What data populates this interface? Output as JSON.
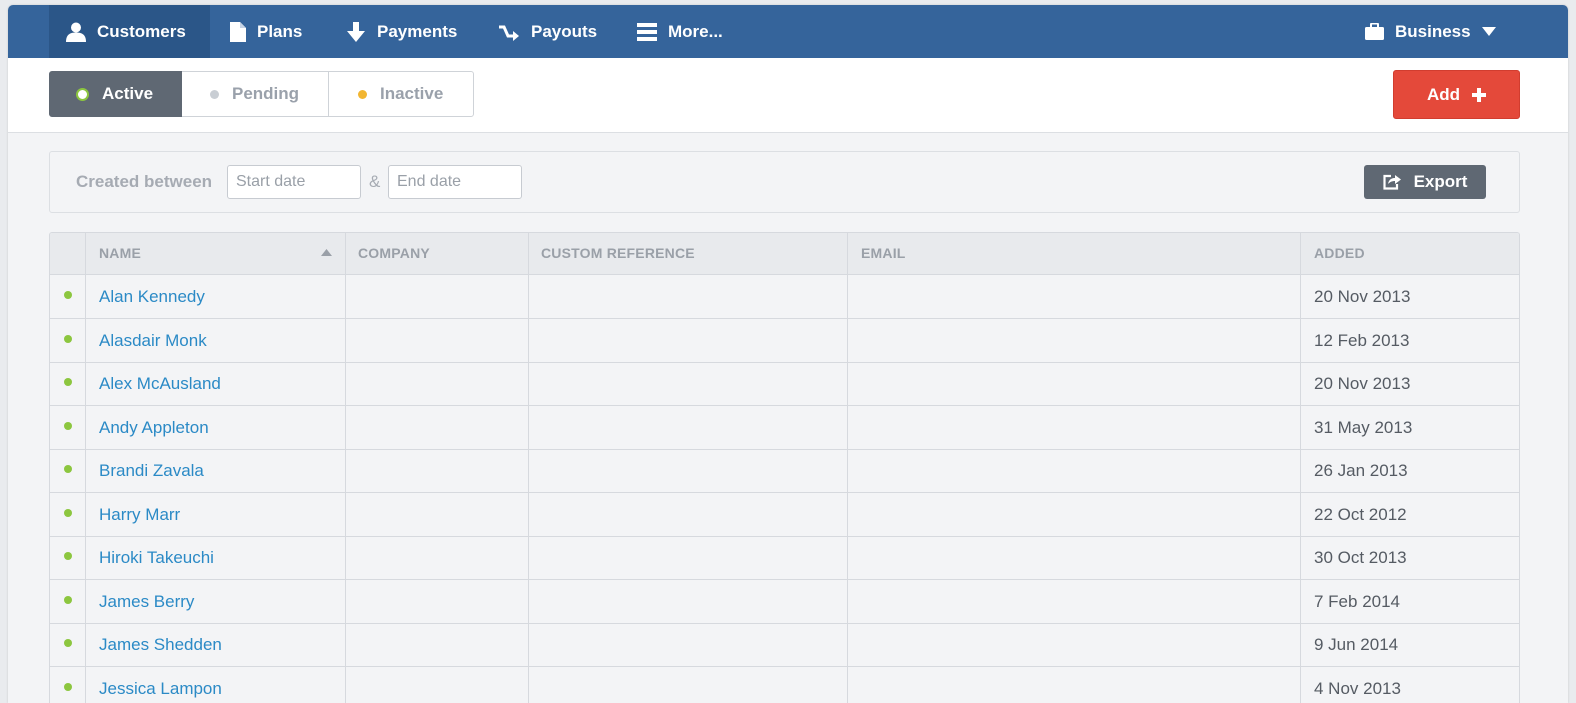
{
  "colors": {
    "nav_bg": "#35649b",
    "nav_active": "#2b5688",
    "accent_red": "#e4493a",
    "link_blue": "#2b8ac6",
    "status_active": "#8cc63f",
    "status_pending": "#c9ced4",
    "status_inactive": "#f2b632"
  },
  "nav": {
    "items": [
      {
        "label": "Customers",
        "icon": "user-icon"
      },
      {
        "label": "Plans",
        "icon": "document-icon"
      },
      {
        "label": "Payments",
        "icon": "download-arrow-icon"
      },
      {
        "label": "Payouts",
        "icon": "payout-arrow-icon"
      },
      {
        "label": "More...",
        "icon": "menu-icon"
      }
    ],
    "business": {
      "label": "Business",
      "icon": "briefcase-icon"
    }
  },
  "tabs": [
    {
      "label": "Active"
    },
    {
      "label": "Pending"
    },
    {
      "label": "Inactive"
    }
  ],
  "add_button": {
    "label": "Add"
  },
  "filter": {
    "label": "Created between",
    "start_placeholder": "Start date",
    "separator": "&",
    "end_placeholder": "End date",
    "export_label": "Export"
  },
  "table": {
    "columns": [
      "NAME",
      "COMPANY",
      "CUSTOM REFERENCE",
      "EMAIL",
      "ADDED"
    ],
    "sort_icon": "sort-up-icon",
    "rows": [
      {
        "name": "Alan Kennedy",
        "company": "",
        "reference": "",
        "email": "",
        "added": "20 Nov 2013"
      },
      {
        "name": "Alasdair Monk",
        "company": "",
        "reference": "",
        "email": "",
        "added": "12 Feb 2013"
      },
      {
        "name": "Alex McAusland",
        "company": "",
        "reference": "",
        "email": "",
        "added": "20 Nov 2013"
      },
      {
        "name": "Andy Appleton",
        "company": "",
        "reference": "",
        "email": "",
        "added": "31 May 2013"
      },
      {
        "name": "Brandi Zavala",
        "company": "",
        "reference": "",
        "email": "",
        "added": "26 Jan 2013"
      },
      {
        "name": "Harry Marr",
        "company": "",
        "reference": "",
        "email": "",
        "added": "22 Oct 2012"
      },
      {
        "name": "Hiroki Takeuchi",
        "company": "",
        "reference": "",
        "email": "",
        "added": "30 Oct 2013"
      },
      {
        "name": "James Berry",
        "company": "",
        "reference": "",
        "email": "",
        "added": "7 Feb 2014"
      },
      {
        "name": "James Shedden",
        "company": "",
        "reference": "",
        "email": "",
        "added": "9 Jun 2014"
      },
      {
        "name": "Jessica Lampon",
        "company": "",
        "reference": "",
        "email": "",
        "added": "4 Nov 2013"
      }
    ]
  }
}
